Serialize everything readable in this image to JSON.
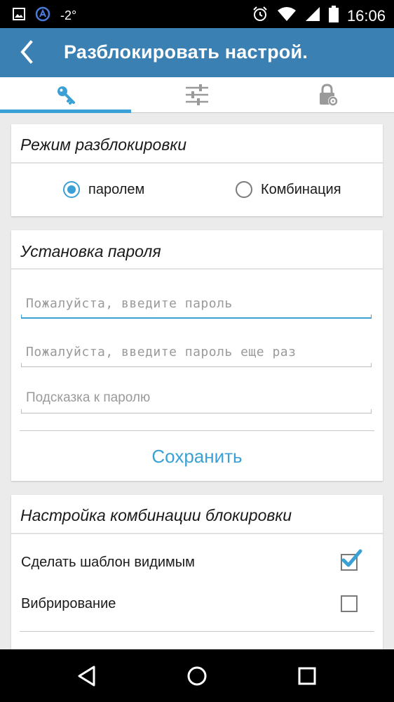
{
  "status_bar": {
    "temperature": "-2°",
    "time": "16:06",
    "icons": [
      "image-icon",
      "app-a-icon",
      "alarm-icon",
      "wifi-icon",
      "signal-icon",
      "battery-icon"
    ]
  },
  "app_bar": {
    "title": "Разблокировать настрой.",
    "back_icon": "chevron-left-icon"
  },
  "tabs": [
    {
      "icon": "key-icon",
      "active": true
    },
    {
      "icon": "sliders-icon",
      "active": false
    },
    {
      "icon": "lock-settings-icon",
      "active": false
    }
  ],
  "unlock_mode": {
    "title": "Режим разблокировки",
    "options": [
      {
        "label": "паролем",
        "selected": true
      },
      {
        "label": "Комбинация",
        "selected": false
      }
    ]
  },
  "password_setup": {
    "title": "Установка пароля",
    "fields": [
      {
        "placeholder": "Пожалуйста, введите пароль",
        "value": ""
      },
      {
        "placeholder": "Пожалуйста, введите пароль еще раз",
        "value": ""
      },
      {
        "placeholder": "Подсказка к паролю",
        "value": ""
      }
    ],
    "save_label": "Сохранить"
  },
  "pattern_setup": {
    "title": "Настройка комбинации блокировки",
    "options": [
      {
        "label": "Сделать шаблон видимым",
        "checked": true
      },
      {
        "label": "Вибрирование",
        "checked": false
      }
    ]
  },
  "colors": {
    "accent": "#3aa0d6",
    "app_bar": "#3b80b2",
    "background": "#ebebeb"
  }
}
